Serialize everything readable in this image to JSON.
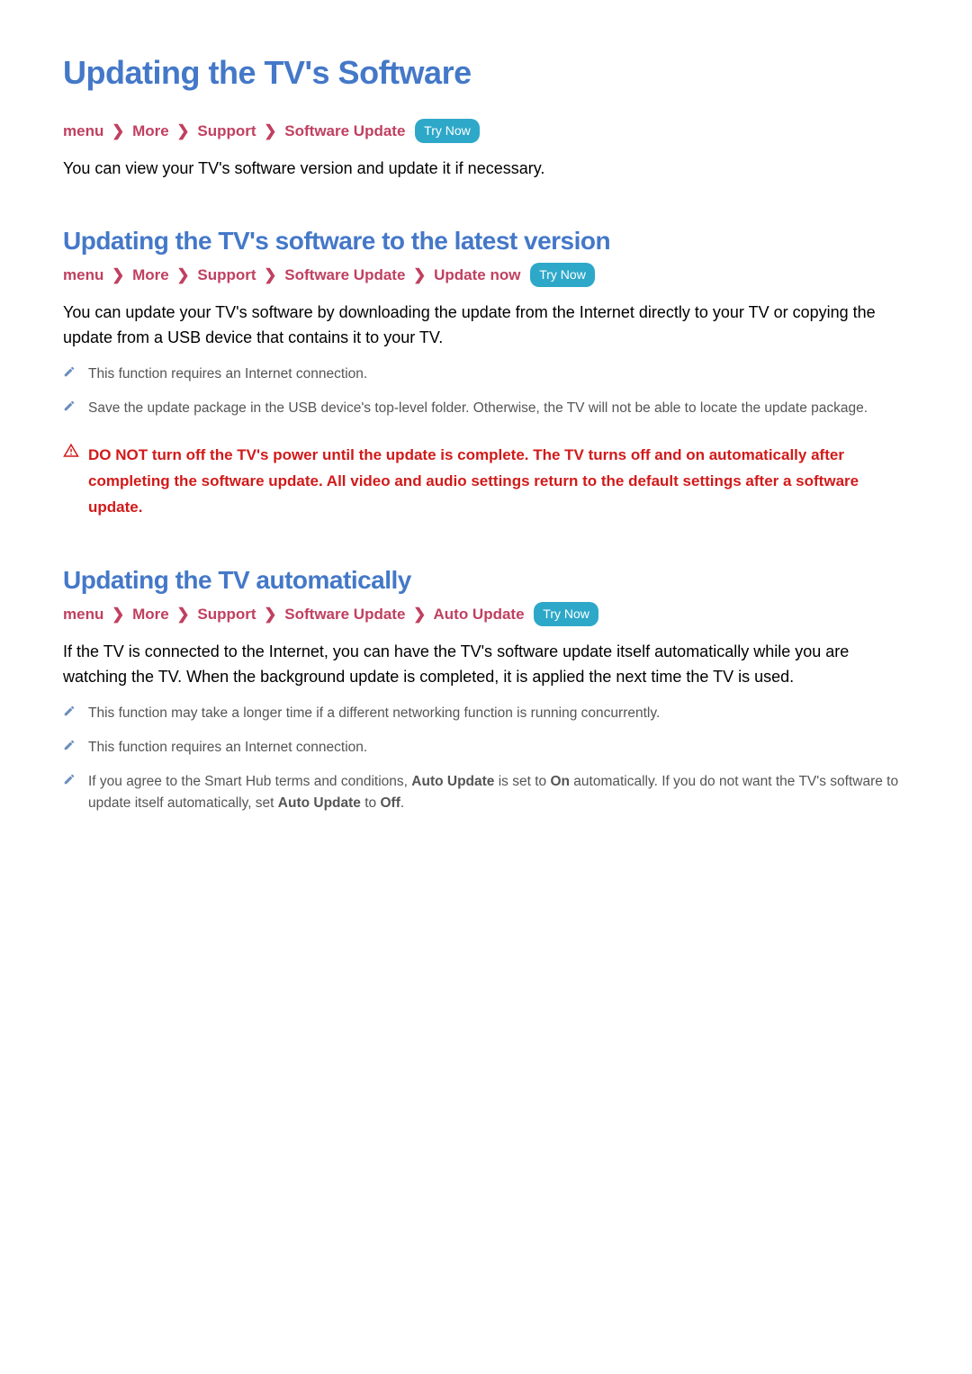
{
  "page_title": "Updating the TV's Software",
  "try_now_label": "Try Now",
  "chevron": "❯",
  "section1": {
    "breadcrumb": [
      "menu",
      "More",
      "Support",
      "Software Update"
    ],
    "body": "You can view your TV's software version and update it if necessary."
  },
  "section2": {
    "heading": "Updating the TV's software to the latest version",
    "breadcrumb": [
      "menu",
      "More",
      "Support",
      "Software Update",
      "Update now"
    ],
    "body": "You can update your TV's software by downloading the update from the Internet directly to your TV or copying the update from a USB device that contains it to your TV.",
    "notes": [
      "This function requires an Internet connection.",
      "Save the update package in the USB device's top-level folder. Otherwise, the TV will not be able to locate the update package."
    ],
    "warning": "DO NOT turn off the TV's power until the update is complete. The TV turns off and on automatically after completing the software update. All video and audio settings return to the default settings after a software update."
  },
  "section3": {
    "heading": "Updating the TV automatically",
    "breadcrumb": [
      "menu",
      "More",
      "Support",
      "Software Update",
      "Auto Update"
    ],
    "body": "If the TV is connected to the Internet, you can have the TV's software update itself automatically while you are watching the TV. When the background update is completed, it is applied the next time the TV is used.",
    "notes": [
      "This function may take a longer time if a different networking function is running concurrently.",
      "This function requires an Internet connection."
    ],
    "note3_parts": {
      "p1": "If you agree to the Smart Hub terms and conditions, ",
      "b1": "Auto Update",
      "p2": " is set to ",
      "b2": "On",
      "p3": " automatically. If you do not want the TV's software to update itself automatically, set ",
      "b3": "Auto Update",
      "p4": " to ",
      "b4": "Off",
      "p5": "."
    }
  }
}
